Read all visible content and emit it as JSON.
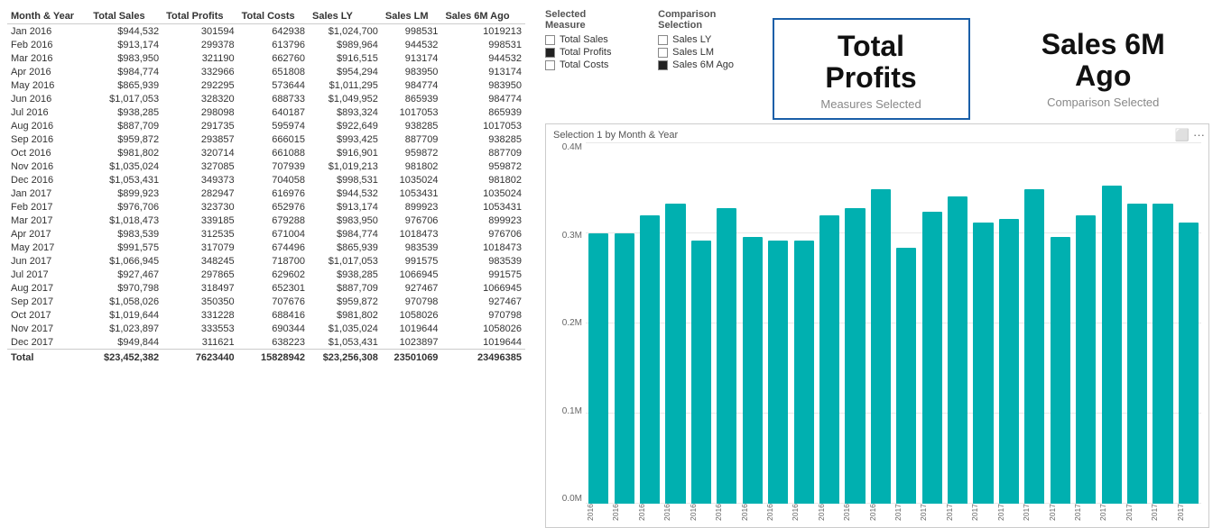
{
  "table": {
    "headers": [
      "Month & Year",
      "Total Sales",
      "Total Profits",
      "Total Costs",
      "Sales LY",
      "Sales LM",
      "Sales 6M Ago"
    ],
    "rows": [
      [
        "Jan 2016",
        "$944,532",
        "301594",
        "642938",
        "$1,024,700",
        "998531",
        "1019213"
      ],
      [
        "Feb 2016",
        "$913,174",
        "299378",
        "613796",
        "$989,964",
        "944532",
        "998531"
      ],
      [
        "Mar 2016",
        "$983,950",
        "321190",
        "662760",
        "$916,515",
        "913174",
        "944532"
      ],
      [
        "Apr 2016",
        "$984,774",
        "332966",
        "651808",
        "$954,294",
        "983950",
        "913174"
      ],
      [
        "May 2016",
        "$865,939",
        "292295",
        "573644",
        "$1,011,295",
        "984774",
        "983950"
      ],
      [
        "Jun 2016",
        "$1,017,053",
        "328320",
        "688733",
        "$1,049,952",
        "865939",
        "984774"
      ],
      [
        "Jul 2016",
        "$938,285",
        "298098",
        "640187",
        "$893,324",
        "1017053",
        "865939"
      ],
      [
        "Aug 2016",
        "$887,709",
        "291735",
        "595974",
        "$922,649",
        "938285",
        "1017053"
      ],
      [
        "Sep 2016",
        "$959,872",
        "293857",
        "666015",
        "$993,425",
        "887709",
        "938285"
      ],
      [
        "Oct 2016",
        "$981,802",
        "320714",
        "661088",
        "$916,901",
        "959872",
        "887709"
      ],
      [
        "Nov 2016",
        "$1,035,024",
        "327085",
        "707939",
        "$1,019,213",
        "981802",
        "959872"
      ],
      [
        "Dec 2016",
        "$1,053,431",
        "349373",
        "704058",
        "$998,531",
        "1035024",
        "981802"
      ],
      [
        "Jan 2017",
        "$899,923",
        "282947",
        "616976",
        "$944,532",
        "1053431",
        "1035024"
      ],
      [
        "Feb 2017",
        "$976,706",
        "323730",
        "652976",
        "$913,174",
        "899923",
        "1053431"
      ],
      [
        "Mar 2017",
        "$1,018,473",
        "339185",
        "679288",
        "$983,950",
        "976706",
        "899923"
      ],
      [
        "Apr 2017",
        "$983,539",
        "312535",
        "671004",
        "$984,774",
        "1018473",
        "976706"
      ],
      [
        "May 2017",
        "$991,575",
        "317079",
        "674496",
        "$865,939",
        "983539",
        "1018473"
      ],
      [
        "Jun 2017",
        "$1,066,945",
        "348245",
        "718700",
        "$1,017,053",
        "991575",
        "983539"
      ],
      [
        "Jul 2017",
        "$927,467",
        "297865",
        "629602",
        "$938,285",
        "1066945",
        "991575"
      ],
      [
        "Aug 2017",
        "$970,798",
        "318497",
        "652301",
        "$887,709",
        "927467",
        "1066945"
      ],
      [
        "Sep 2017",
        "$1,058,026",
        "350350",
        "707676",
        "$959,872",
        "970798",
        "927467"
      ],
      [
        "Oct 2017",
        "$1,019,644",
        "331228",
        "688416",
        "$981,802",
        "1058026",
        "970798"
      ],
      [
        "Nov 2017",
        "$1,023,897",
        "333553",
        "690344",
        "$1,035,024",
        "1019644",
        "1058026"
      ],
      [
        "Dec 2017",
        "$949,844",
        "311621",
        "638223",
        "$1,053,431",
        "1023897",
        "1019644"
      ]
    ],
    "footer": [
      "Total",
      "$23,452,382",
      "7623440",
      "15828942",
      "$23,256,308",
      "23501069",
      "23496385"
    ]
  },
  "legend": {
    "title_selected": "Selected Measure",
    "title_comparison": "Comparison Selection",
    "selected_items": [
      {
        "label": "Total Sales",
        "checked": false
      },
      {
        "label": "Total Profits",
        "checked": true
      },
      {
        "label": "Total Costs",
        "checked": false
      }
    ],
    "comparison_items": [
      {
        "label": "Sales LY",
        "checked": false
      },
      {
        "label": "Sales LM",
        "checked": false
      },
      {
        "label": "Sales 6M Ago",
        "checked": true
      }
    ]
  },
  "selection_display": {
    "measure_label": "Total Profits",
    "measure_sub": "Measures Selected",
    "comparison_label": "Sales 6M Ago",
    "comparison_sub": "Comparison Selected"
  },
  "chart": {
    "title": "Selection 1 by Month & Year",
    "y_labels": [
      "0.4M",
      "0.3M",
      "0.2M",
      "0.1M",
      "0.0M"
    ],
    "bar_heights_pct": [
      75,
      75,
      80,
      83,
      73,
      82,
      74,
      73,
      73,
      80,
      82,
      87,
      71,
      81,
      85,
      78,
      79,
      87,
      74,
      80,
      88,
      83,
      83,
      78
    ],
    "x_labels": [
      "2016",
      "2016",
      "2016",
      "2016",
      "2016",
      "2016",
      "2016",
      "2016",
      "2016",
      "2016",
      "2016",
      "2016",
      "2017",
      "2017",
      "2017",
      "2017",
      "2017",
      "2017",
      "2017",
      "2017",
      "2017",
      "2017",
      "2017",
      "2017"
    ]
  },
  "toolbar": {
    "expand_icon": "⬜",
    "menu_icon": "···"
  }
}
